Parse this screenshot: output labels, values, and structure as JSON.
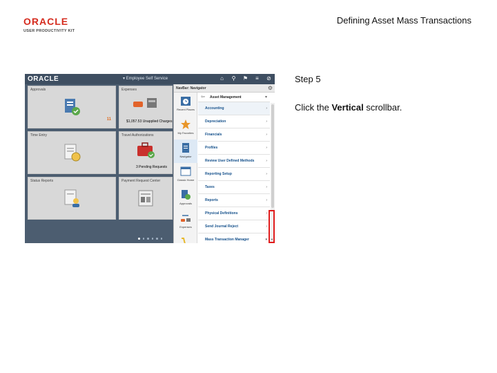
{
  "logo": {
    "brand": "ORACLE",
    "sub": "USER PRODUCTIVITY KIT"
  },
  "doc_title": "Defining Asset Mass Transactions",
  "screenshot": {
    "topbar": {
      "logo": "ORACLE",
      "title": "▾ Employee Self Service",
      "icons": [
        "home-icon",
        "search-icon",
        "flag-icon",
        "menu-icon",
        "compass-icon"
      ]
    },
    "tiles": [
      {
        "title": "Approvals",
        "footer": "",
        "count": "11"
      },
      {
        "title": "Expenses",
        "footer": "$1,057.53 Unapplied Charges",
        "count": ""
      },
      {
        "title": "Time Entry",
        "footer": "",
        "count": ""
      },
      {
        "title": "Travel Authorizations",
        "footer": "3 Pending Requests",
        "count": ""
      },
      {
        "title": "Status Reports",
        "footer": "",
        "count": ""
      },
      {
        "title": "Payment Request Center",
        "footer": "",
        "count": ""
      }
    ],
    "nav": {
      "header": "NavBar: Navigator",
      "rail": [
        {
          "label": "Recent Places"
        },
        {
          "label": "My Favorites"
        },
        {
          "label": "Navigator"
        },
        {
          "label": "Classic Home"
        },
        {
          "label": "Approvals"
        },
        {
          "label": "Expenses"
        }
      ],
      "submenu_title": "Asset Management",
      "items": [
        "Accounting",
        "Depreciation",
        "Financials",
        "Profiles",
        "Review User Defined Methods",
        "Reporting Setup",
        "Taxes",
        "Reports",
        "Physical Definitions",
        "Send Journal Reject",
        "Mass Transaction Manager"
      ]
    }
  },
  "step": "Step 5",
  "instruction": {
    "prefix": "Click the ",
    "bold": "Vertical",
    "suffix": " scrollbar."
  },
  "colors": {
    "oracle_red": "#d52b1e",
    "highlight": "#e01b1b",
    "link": "#14508b"
  }
}
